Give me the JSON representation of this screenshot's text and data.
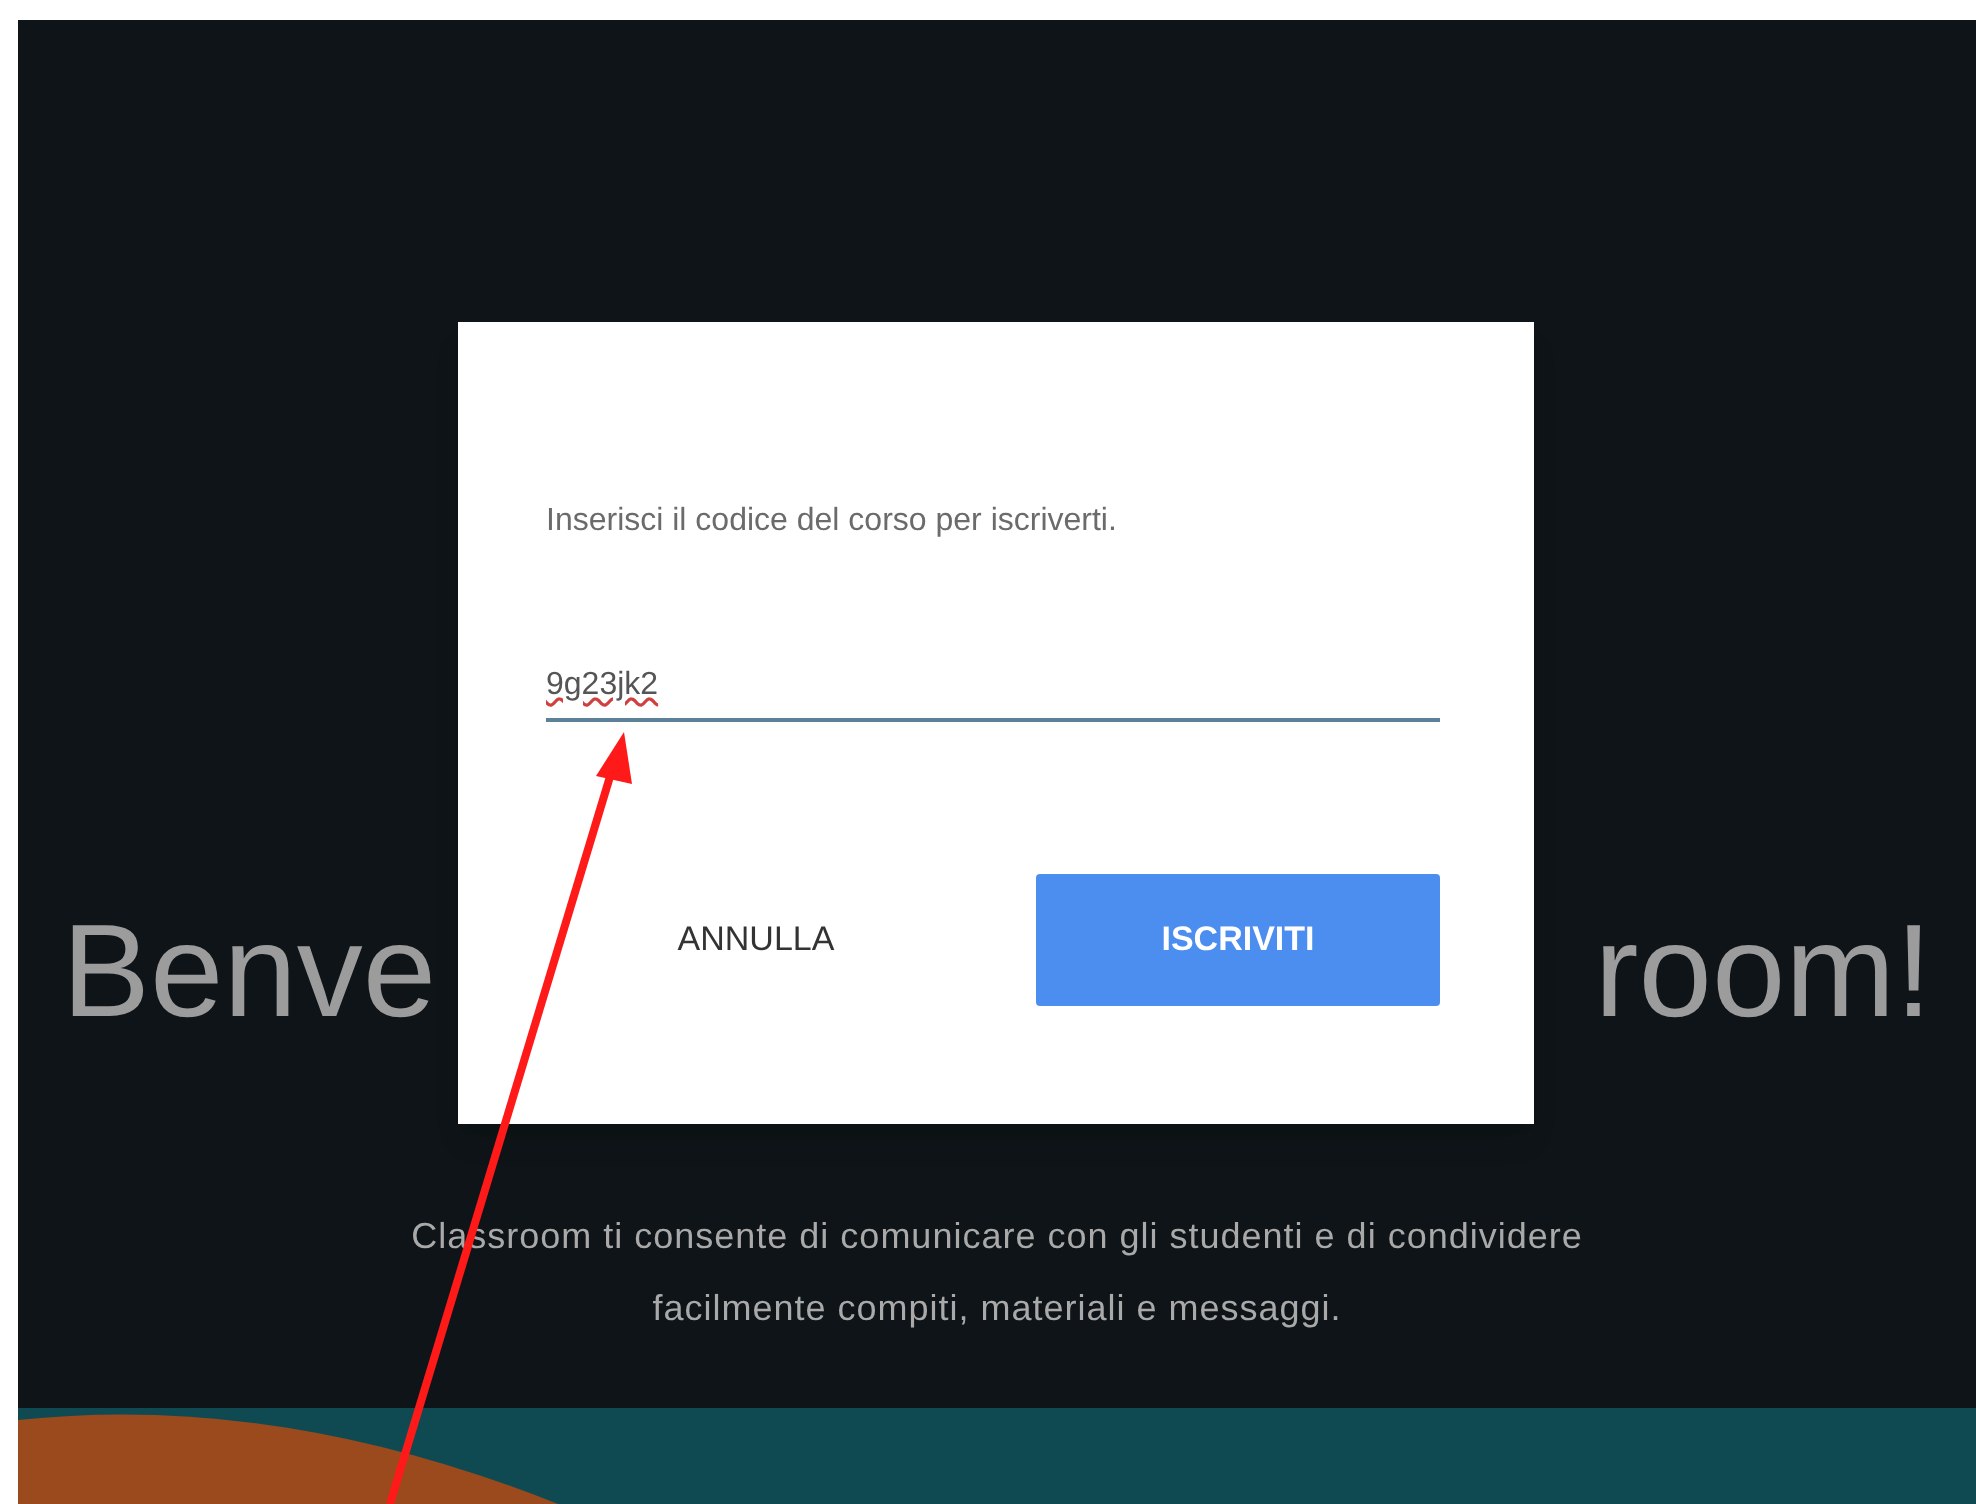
{
  "background": {
    "heading_left": "Benve",
    "heading_right": "room!",
    "description": "Classroom ti consente di comunicare con gli studenti e di condividere facilmente compiti, materiali e messaggi."
  },
  "dialog": {
    "prompt": "Inserisci il codice del corso per iscriverti.",
    "code_field": {
      "value": "9g23jk2"
    },
    "buttons": [
      {
        "label": "ANNULLA",
        "kind": "text"
      },
      {
        "label": "ISCRIVITI",
        "kind": "primary"
      }
    ]
  }
}
